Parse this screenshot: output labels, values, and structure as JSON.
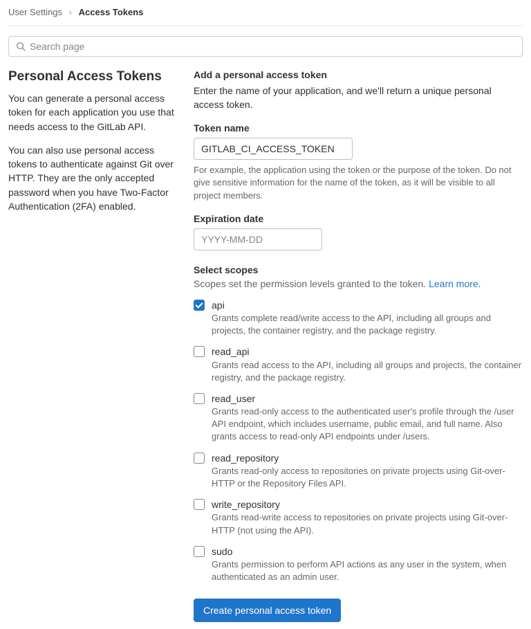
{
  "breadcrumb": {
    "parent": "User Settings",
    "current": "Access Tokens"
  },
  "search": {
    "placeholder": "Search page"
  },
  "left": {
    "title": "Personal Access Tokens",
    "para1": "You can generate a personal access token for each application you use that needs access to the GitLab API.",
    "para2": "You can also use personal access tokens to authenticate against Git over HTTP. They are the only accepted password when you have Two-Factor Authentication (2FA) enabled."
  },
  "form": {
    "heading": "Add a personal access token",
    "intro": "Enter the name of your application, and we'll return a unique personal access token.",
    "token_name_label": "Token name",
    "token_name_value": "GITLAB_CI_ACCESS_TOKEN",
    "token_name_help": "For example, the application using the token or the purpose of the token. Do not give sensitive information for the name of the token, as it will be visible to all project members.",
    "expiration_label": "Expiration date",
    "expiration_placeholder": "YYYY-MM-DD",
    "scopes_heading": "Select scopes",
    "scopes_intro": "Scopes set the permission levels granted to the token. ",
    "scopes_link": "Learn more.",
    "submit_label": "Create personal access token"
  },
  "scopes": [
    {
      "name": "api",
      "checked": true,
      "desc": "Grants complete read/write access to the API, including all groups and projects, the container registry, and the package registry."
    },
    {
      "name": "read_api",
      "checked": false,
      "desc": "Grants read access to the API, including all groups and projects, the container registry, and the package registry."
    },
    {
      "name": "read_user",
      "checked": false,
      "desc": "Grants read-only access to the authenticated user's profile through the /user API endpoint, which includes username, public email, and full name. Also grants access to read-only API endpoints under /users."
    },
    {
      "name": "read_repository",
      "checked": false,
      "desc": "Grants read-only access to repositories on private projects using Git-over-HTTP or the Repository Files API."
    },
    {
      "name": "write_repository",
      "checked": false,
      "desc": "Grants read-write access to repositories on private projects using Git-over-HTTP (not using the API)."
    },
    {
      "name": "sudo",
      "checked": false,
      "desc": "Grants permission to perform API actions as any user in the system, when authenticated as an admin user."
    }
  ]
}
